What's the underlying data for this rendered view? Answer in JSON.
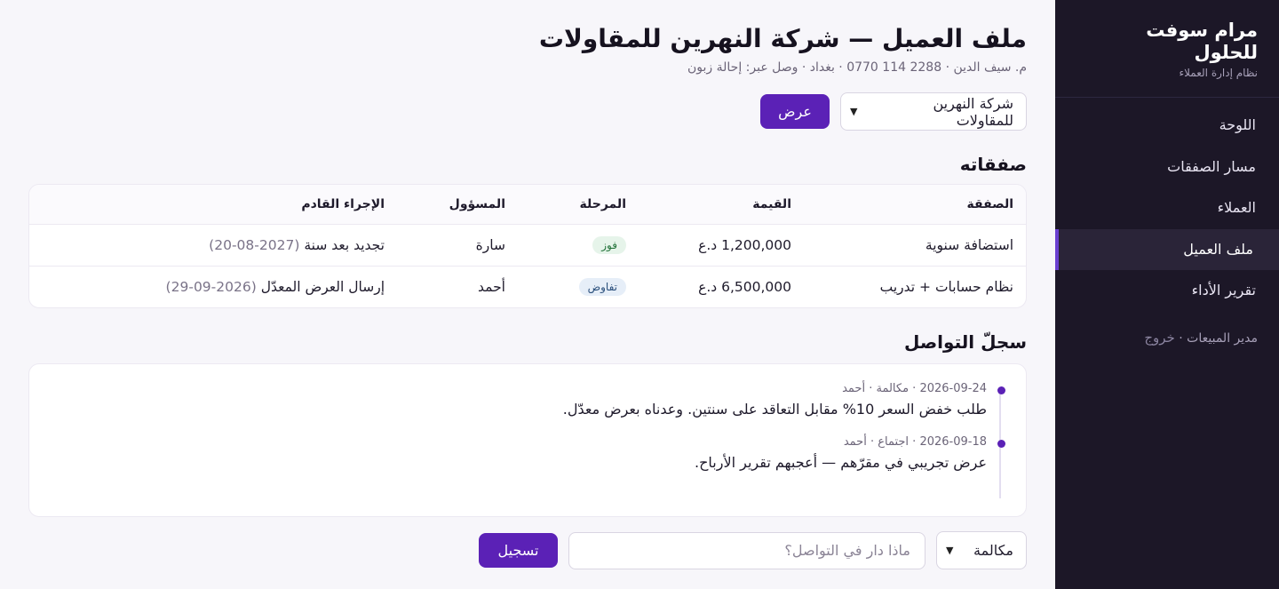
{
  "sidebar": {
    "brand_title": "مرام سوفت للحلول",
    "brand_sub": "نظام إدارة العملاء",
    "items": [
      {
        "label": "اللوحة",
        "active": false
      },
      {
        "label": "مسار الصفقات",
        "active": false
      },
      {
        "label": "العملاء",
        "active": false
      },
      {
        "label": "ملف العميل",
        "active": true
      },
      {
        "label": "تقرير الأداء",
        "active": false
      }
    ],
    "user_role": "مدير المبيعات ·",
    "logout_label": "خروج"
  },
  "header": {
    "title": "ملف العميل — شركة النهرين للمقاولات",
    "subtitle": "م. سيف الدين · 2288 114 0770 · بغداد · وصل عبر: إحالة زبون"
  },
  "client_select": {
    "value": "شركة النهرين للمقاولات",
    "view_button": "عرض"
  },
  "deals": {
    "title": "صفقاته",
    "columns": [
      "الصفقة",
      "القيمة",
      "المرحلة",
      "المسؤول",
      "الإجراء القادم"
    ],
    "rows": [
      {
        "deal": "استضافة سنوية",
        "value": "1,200,000 د.ع",
        "stage": "فوز",
        "stage_type": "win",
        "owner": "سارة",
        "next_action": "تجديد بعد سنة",
        "next_date": "(2027-08-20)"
      },
      {
        "deal": "نظام حسابات + تدريب",
        "value": "6,500,000 د.ع",
        "stage": "تفاوض",
        "stage_type": "negotiation",
        "owner": "أحمد",
        "next_action": "إرسال العرض المعدّل",
        "next_date": "(2026-09-29)"
      }
    ]
  },
  "log": {
    "title": "سجلّ التواصل",
    "entries": [
      {
        "meta": "2026-09-24 · مكالمة · أحمد",
        "text": "طلب خفض السعر 10% مقابل التعاقد على سنتين. وعدناه بعرض معدّل."
      },
      {
        "meta": "2026-09-18 · اجتماع · أحمد",
        "text": "عرض تجريبي في مقرّهم — أعجبهم تقرير الأرباح."
      }
    ]
  },
  "composer": {
    "type_value": "مكالمة",
    "placeholder": "ماذا دار في التواصل؟",
    "submit_label": "تسجيل"
  },
  "colors": {
    "accent": "#5b21b6",
    "sidebar_bg": "#1c1727",
    "win_badge": "#e6f4ea",
    "negotiation_badge": "#e6eef8"
  }
}
